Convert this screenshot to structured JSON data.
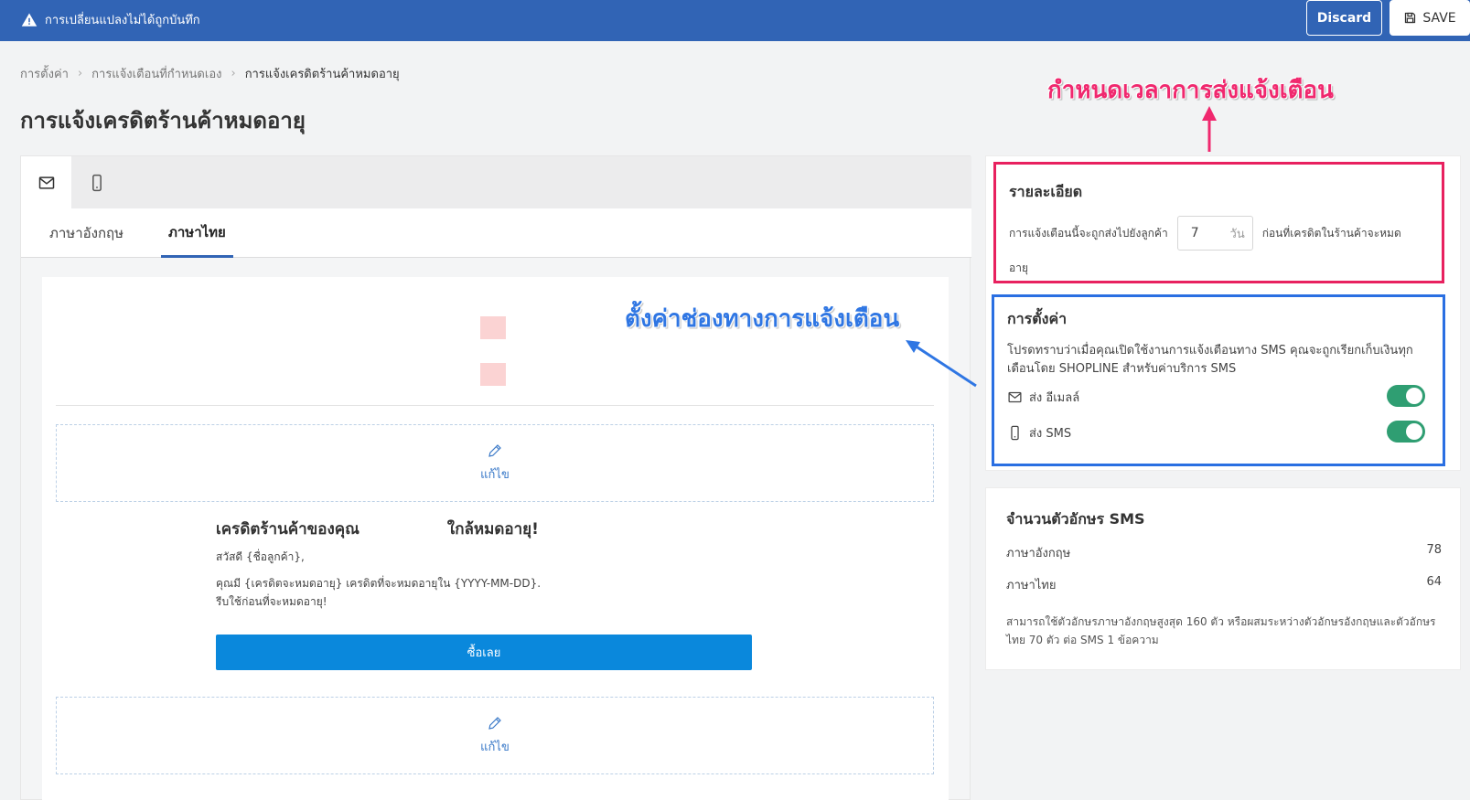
{
  "topbar": {
    "warning": "การเปลี่ยนแปลงไม่ได้ถูกบันทึก",
    "discard_label": "Discard",
    "save_label": "SAVE"
  },
  "breadcrumb": {
    "items": [
      "การตั้งค่า",
      "การแจ้งเตือนที่กำหนดเอง",
      "การแจ้งเครดิตร้านค้าหมดอายุ"
    ]
  },
  "page": {
    "title": "การแจ้งเครดิตร้านค้าหมดอายุ"
  },
  "channel_tabs": {
    "active": "email",
    "items": [
      "mail-icon",
      "mobile-icon"
    ]
  },
  "lang_tabs": {
    "items": [
      "ภาษาอังกฤษ",
      "ภาษาไทย"
    ],
    "active": "ภาษาไทย"
  },
  "email": {
    "edit_label": "แก้ไข",
    "heading_start": "เครดิตร้านค้าของคุณ",
    "heading_end": "ใกล้หมดอายุ!",
    "greeting": "สวัสดี {ชื่อลูกค้า},",
    "body_line1": "คุณมี {เครดิตจะหมดอายุ} เครดิตที่จะหมดอายุใน {YYYY-MM-DD}.",
    "body_line2": "รีบใช้ก่อนที่จะหมดอายุ!",
    "button": "ซื้อเลย"
  },
  "details": {
    "title": "รายละเอียด",
    "text_before": "การแจ้งเตือนนี้จะถูกส่งไปยังลูกค้า",
    "days_value": "7",
    "days_unit": "วัน",
    "text_after": "ก่อนที่เครดิตในร้านค้าจะหมด",
    "text_after2": "อายุ"
  },
  "settings": {
    "title": "การตั้งค่า",
    "notice": "โปรดทราบว่าเมื่อคุณเปิดใช้งานการแจ้งเตือนทาง SMS คุณจะถูกเรียกเก็บเงินทุกเดือนโดย SHOPLINE สำหรับค่าบริการ SMS",
    "send_email": "ส่ง อีเมลล์",
    "send_email_on": true,
    "send_sms": "ส่ง SMS",
    "send_sms_on": true
  },
  "sms_count": {
    "title": "จำนวนตัวอักษร SMS",
    "rows": [
      {
        "label": "ภาษาอังกฤษ",
        "value": "78"
      },
      {
        "label": "ภาษาไทย",
        "value": "64"
      }
    ],
    "note": "สามารถใช้ตัวอักษรภาษาอังกฤษสูงสุด 160 ตัว หรือผสมระหว่างตัวอักษรอังกฤษและตัวอักษรไทย 70 ตัว ต่อ SMS 1 ข้อความ"
  },
  "annotations": {
    "schedule": "กำหนดเวลาการส่งแจ้งเตือน",
    "channels": "ตั้งค่าช่องทางการแจ้งเตือน"
  },
  "colors": {
    "topbar": "#3164b5",
    "accent_red": "#e8215f",
    "accent_blue": "#2a6fe2",
    "toggle_on": "#2f9e72",
    "buy_button": "#0a88dc"
  }
}
